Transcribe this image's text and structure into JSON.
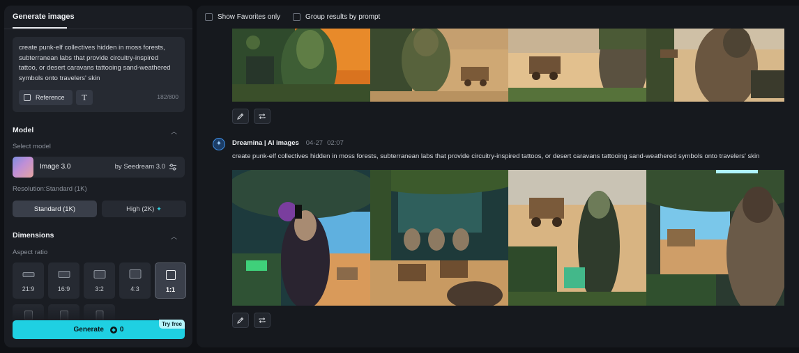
{
  "sidebar": {
    "tab_label": "Generate images",
    "prompt": {
      "text": "create punk-elf collectives hidden in moss forests, subterranean labs that provide circuitry-inspired tattoo, or desert caravans tattooing sand-weathered symbols onto travelers' skin",
      "reference_label": "Reference",
      "text_tool_label": "T",
      "counter": "182/800"
    },
    "model": {
      "section_title": "Model",
      "select_label": "Select model",
      "name": "Image 3.0",
      "provider": "by Seedream 3.0",
      "settings_icon": "sliders-icon"
    },
    "resolution": {
      "label": "Resolution:Standard (1K)",
      "options": [
        "Standard (1K)",
        "High (2K)"
      ],
      "selected": "Standard (1K)"
    },
    "dimensions": {
      "section_title": "Dimensions",
      "aspect_label": "Aspect ratio",
      "ratios": [
        "21:9",
        "16:9",
        "3:2",
        "4:3",
        "1:1"
      ],
      "selected": "1:1"
    },
    "generate": {
      "label": "Generate",
      "credits": "0",
      "badge": "Try free",
      "color": "#1fd0e2"
    }
  },
  "filters": {
    "favorites_label": "Show Favorites only",
    "group_label": "Group results by prompt"
  },
  "result": {
    "author": "Dreamina | AI images",
    "date": "04-27",
    "time": "02:07",
    "prompt": "create punk-elf collectives hidden in moss forests, subterranean labs that provide circuitry-inspired tattoos, or desert caravans tattooing sand-weathered symbols onto travelers' skin"
  },
  "actions": {
    "edit_icon": "pencil-icon",
    "regenerate_icon": "repeat-icon"
  }
}
